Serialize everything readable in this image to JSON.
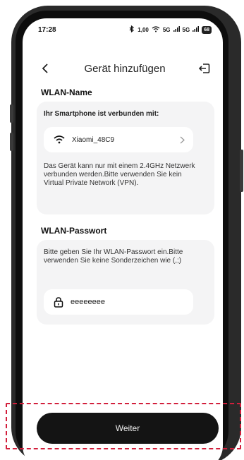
{
  "statusbar": {
    "time": "17:28",
    "net_speed": "1,00",
    "signal_1": "5G",
    "signal_2": "5G",
    "battery": "68"
  },
  "header": {
    "title": "Gerät hinzufügen"
  },
  "wlan_name": {
    "section_title": "WLAN-Name",
    "connected_label": "Ihr Smartphone ist verbunden mit:",
    "network_name": "Xiaomi_48C9",
    "note": "Das Gerät kann nur mit einem 2.4GHz Netzwerk verbunden werden.Bitte verwenden Sie kein Virtual Private Network (VPN)."
  },
  "wlan_password": {
    "section_title": "WLAN-Passwort",
    "note": "Bitte geben Sie Ihr WLAN-Passwort ein.Bitte verwenden Sie keine Sonderzeichen wie (,;)",
    "value": "eeeeeeee"
  },
  "footer": {
    "next_label": "Weiter"
  }
}
